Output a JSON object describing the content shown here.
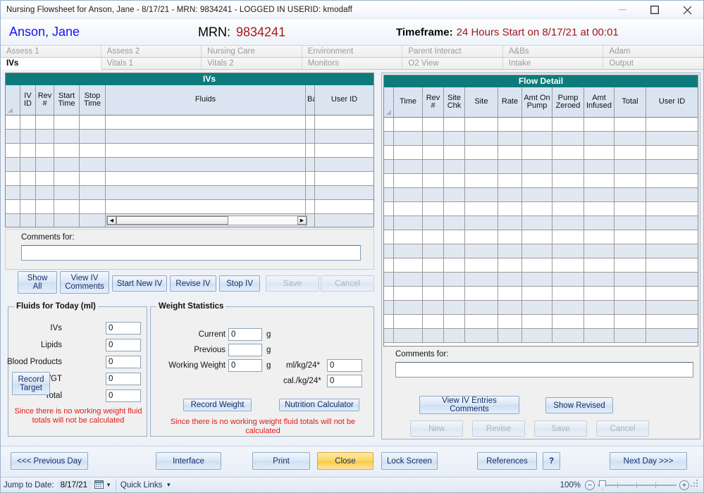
{
  "window": {
    "title": "Nursing Flowsheet for Anson, Jane - 8/17/21 - MRN: 9834241   -  LOGGED IN USERID: kmodaff",
    "minimize_label": "minimize-icon",
    "maximize_label": "maximize-icon",
    "close_label": "close-icon"
  },
  "patient_header": {
    "patient_name": "Anson, Jane",
    "mrn_label": "MRN:",
    "mrn_value": "9834241",
    "timeframe_label": "Timeframe:",
    "timeframe_value": "24 Hours Start on 8/17/21 at 00:01"
  },
  "tabs": {
    "row1": [
      {
        "label": "Assess 1",
        "active": false
      },
      {
        "label": "Assess 2",
        "active": false
      },
      {
        "label": "Nursing Care",
        "active": false
      },
      {
        "label": "Environment",
        "active": false
      },
      {
        "label": "Parent Interact",
        "active": false
      },
      {
        "label": "A&Bs",
        "active": false
      },
      {
        "label": "Adam",
        "active": false
      }
    ],
    "row2": [
      {
        "label": "IVs",
        "active": true
      },
      {
        "label": "Vitals 1",
        "active": false
      },
      {
        "label": "Vitals 2",
        "active": false
      },
      {
        "label": "Monitors",
        "active": false
      },
      {
        "label": "O2 View",
        "active": false
      },
      {
        "label": "Intake",
        "active": false
      },
      {
        "label": "Output",
        "active": false
      }
    ]
  },
  "ivs_grid": {
    "title": "IVs",
    "columns": [
      "IV\nID",
      "Rev\n#",
      "Start\nTime",
      "Stop\nTime",
      "Fluids",
      "Ba",
      "User ID"
    ],
    "rows": [],
    "row_count": 8,
    "scrollbar": {
      "left_arrow": "◀",
      "right_arrow": "▶"
    }
  },
  "flow_detail_grid": {
    "title": "Flow Detail",
    "columns": [
      "Time",
      "Rev\n#",
      "Site\nChk",
      "Site",
      "Rate",
      "Amt On\nPump",
      "Pump\nZeroed",
      "Amt\nInfused",
      "Total",
      "User ID"
    ],
    "rows": [],
    "row_count": 16
  },
  "left_comments": {
    "label": "Comments for:",
    "value": "",
    "placeholder": ""
  },
  "left_buttons": [
    {
      "label": "Show\nAll",
      "disabled": false
    },
    {
      "label": "View IV\nComments",
      "disabled": false
    },
    {
      "label": "Start New IV",
      "disabled": false
    },
    {
      "label": "Revise IV",
      "disabled": false
    },
    {
      "label": "Stop IV",
      "disabled": false
    },
    {
      "label": "Save",
      "disabled": true
    },
    {
      "label": "Cancel",
      "disabled": true
    }
  ],
  "fluids_group": {
    "title": "Fluids for Today (ml)",
    "record_target_button": "Record\nTarget",
    "fields": [
      {
        "label": "IVs",
        "value": "0"
      },
      {
        "label": "Lipids",
        "value": "0"
      },
      {
        "label": "Blood Products",
        "value": "0"
      },
      {
        "label": "Oral/NG/GT",
        "value": "0"
      },
      {
        "label": "Total",
        "value": "0"
      }
    ],
    "warning": "Since there is no working weight fluid totals will not be calculated"
  },
  "weight_group": {
    "title": "Weight Statistics",
    "fields": [
      {
        "label": "Current",
        "value": "0",
        "unit": "g"
      },
      {
        "label": "Previous",
        "value": "",
        "unit": "g"
      },
      {
        "label": "Working Weight",
        "value": "0",
        "unit": "g"
      }
    ],
    "rate_fields": [
      {
        "label": "ml/kg/24*",
        "value": "0"
      },
      {
        "label": "cal./kg/24*",
        "value": "0"
      }
    ],
    "record_weight_button": "Record Weight",
    "nutrition_calculator_button": "Nutrition Calculator",
    "warning": "Since there is no working weight fluid totals will not be calculated"
  },
  "right_comments": {
    "label": "Comments for:",
    "value": "",
    "placeholder": ""
  },
  "right_buttons": [
    {
      "label": "View IV Entries\nComments",
      "disabled": false
    },
    {
      "label": "Show Revised",
      "disabled": false
    },
    {
      "label": "New",
      "disabled": true
    },
    {
      "label": "Revise",
      "disabled": true
    },
    {
      "label": "Save",
      "disabled": true
    },
    {
      "label": "Cancel",
      "disabled": true
    }
  ],
  "footer_buttons": [
    {
      "label": "<<< Previous Day",
      "style": "normal"
    },
    {
      "label": "Interface",
      "style": "normal"
    },
    {
      "label": "Print",
      "style": "normal"
    },
    {
      "label": "Close",
      "style": "yellow"
    },
    {
      "label": "Lock Screen",
      "style": "normal"
    },
    {
      "label": "References",
      "style": "normal"
    },
    {
      "label": "?",
      "style": "normal"
    },
    {
      "label": "Next Day >>>",
      "style": "normal"
    }
  ],
  "statusbar": {
    "jump_to_date_label": "Jump to Date:",
    "jump_to_date_value": "8/17/21",
    "calendar_icon": "calendar-icon",
    "quick_links_label": "Quick Links",
    "zoom_percent": "100%",
    "zoom_out_icon": "−",
    "zoom_in_icon": "+"
  },
  "colors": {
    "grid_header_teal": "#0d7b7b",
    "accent_blue": "#1414ee",
    "alert_red": "#b01414",
    "warning_red": "#e01b1b",
    "close_yellow": "#fcd667"
  }
}
